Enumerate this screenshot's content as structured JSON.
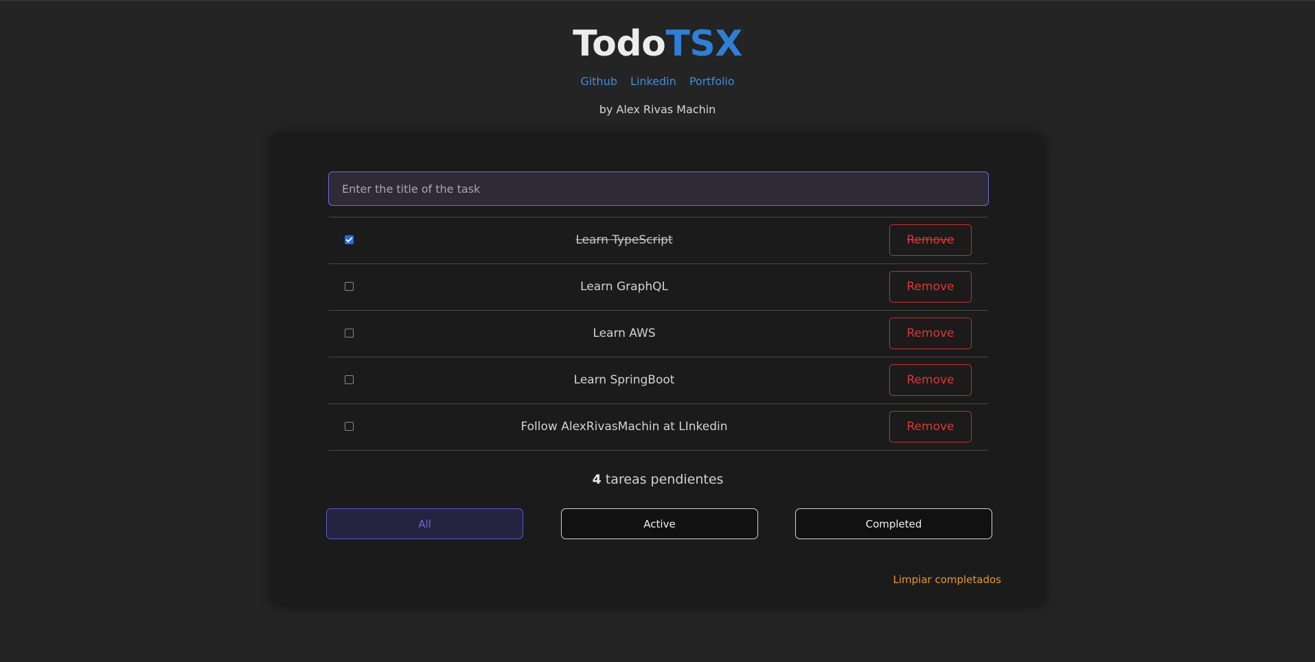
{
  "header": {
    "title_part1": "Todo",
    "title_part2": "TSX",
    "links": [
      "Github",
      "Linkedin",
      "Portfolio"
    ],
    "byline": "by Alex Rivas Machin"
  },
  "input": {
    "placeholder": "Enter the title of the task",
    "value": ""
  },
  "tasks": [
    {
      "title": "Learn TypeScript",
      "completed": true,
      "remove_label": "Remove"
    },
    {
      "title": "Learn GraphQL",
      "completed": false,
      "remove_label": "Remove"
    },
    {
      "title": "Learn AWS",
      "completed": false,
      "remove_label": "Remove"
    },
    {
      "title": "Learn SpringBoot",
      "completed": false,
      "remove_label": "Remove"
    },
    {
      "title": "Follow AlexRivasMachin at LInkedin",
      "completed": false,
      "remove_label": "Remove"
    }
  ],
  "footer": {
    "pending_count": "4",
    "pending_text": "tareas pendientes",
    "filters": [
      "All",
      "Active",
      "Completed"
    ],
    "selected_filter": "All",
    "clear_label": "Limpiar completados"
  },
  "colors": {
    "background": "#242424",
    "card": "#1b1b1b",
    "accent_blue": "#2f7ed8",
    "link_blue": "#3c8fe0",
    "danger_red": "#e23535",
    "filter_selected": "#6a6ae8",
    "clear_orange": "#e49a2c"
  }
}
